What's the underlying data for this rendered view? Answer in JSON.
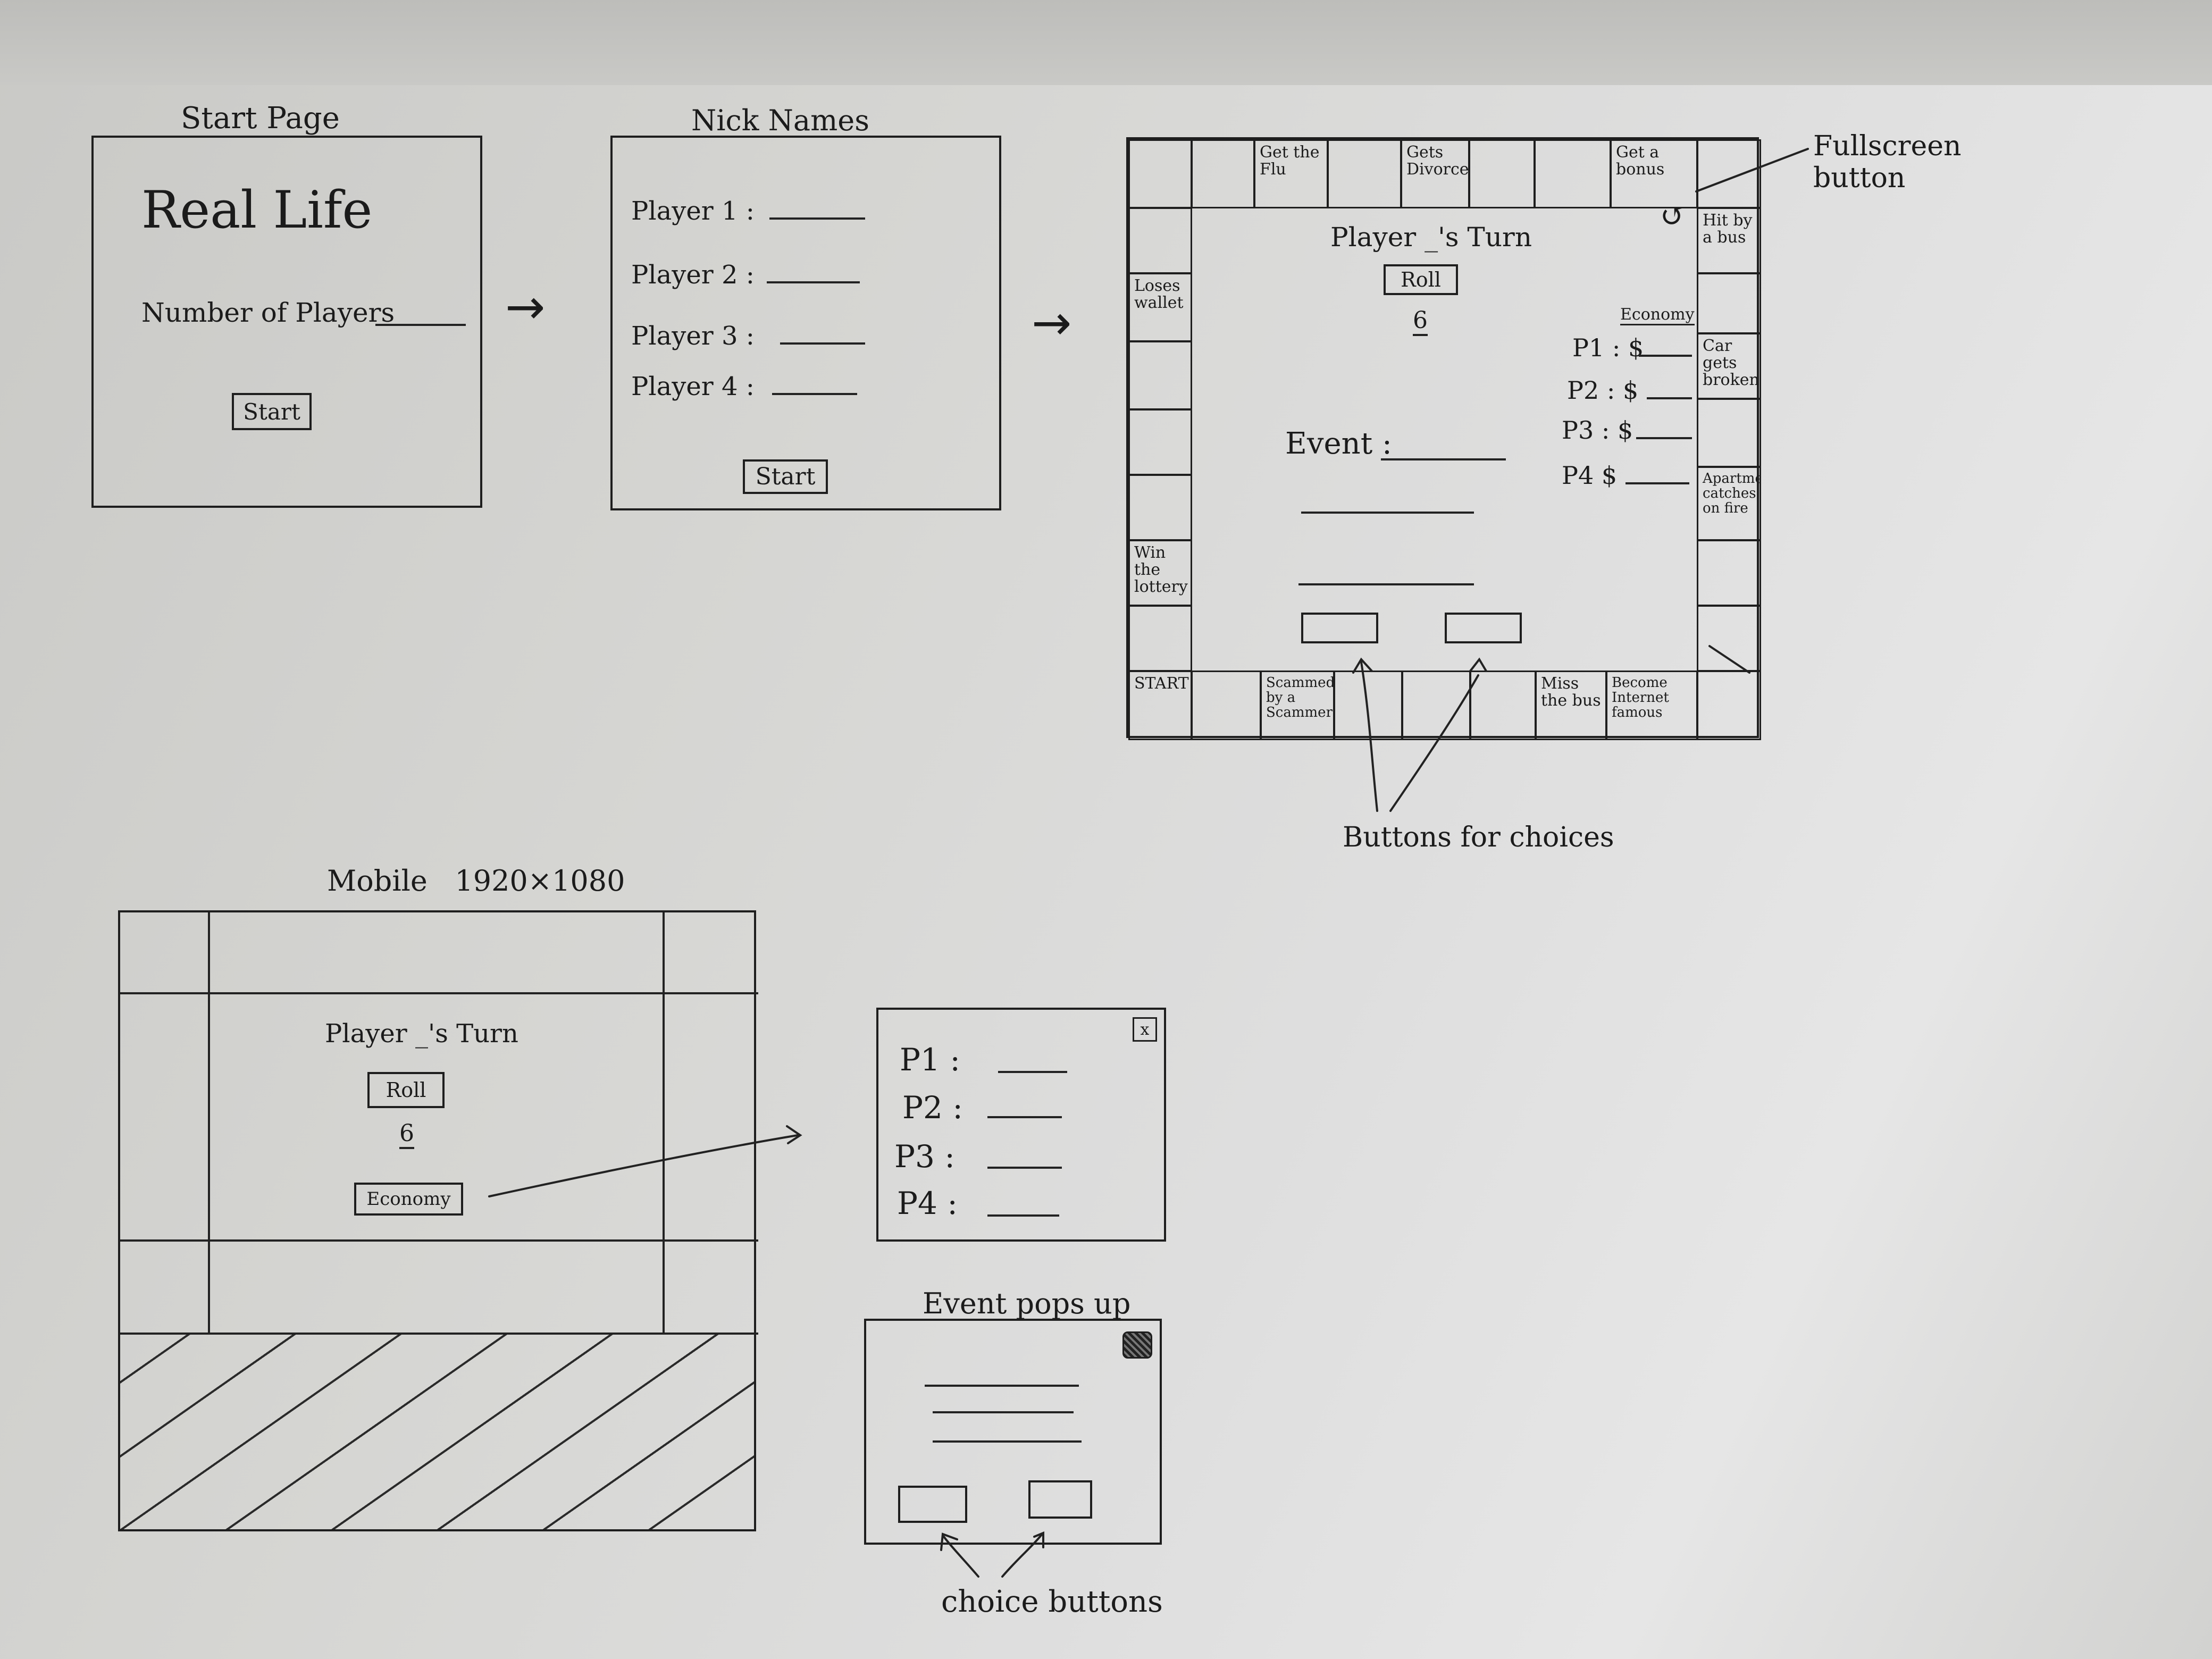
{
  "start_page": {
    "heading": "Start Page",
    "title": "Real Life",
    "num_players_label": "Number of Players",
    "start_button": "Start"
  },
  "nick_names": {
    "heading": "Nick Names",
    "players": [
      "Player 1 :",
      "Player 2 :",
      "Player 3 :",
      "Player 4 :"
    ],
    "start_button": "Start"
  },
  "flow_arrows": [
    "→",
    "→"
  ],
  "board": {
    "top_cells": [
      "Get the Flu",
      "Gets Divorced",
      "Get a bonus"
    ],
    "right_cells": [
      "Hit by a bus",
      "Car gets broken",
      "Apartment catches on fire"
    ],
    "left_cells": [
      "Loses wallet",
      "Win the lottery"
    ],
    "bottom_cells": [
      "START",
      "Scammed by a Scammer",
      "Miss the bus",
      "Become Internet famous"
    ],
    "turn_text": "Player _'s Turn",
    "roll_button": "Roll",
    "dice_value": "6",
    "event_label": "Event :",
    "economy_label": "Economy",
    "player_money": [
      "P1 : $",
      "P2 : $",
      "P3 : $",
      "P4 $"
    ]
  },
  "annotations": {
    "fullscreen": "Fullscreen button",
    "choice_buttons": "Buttons for choices",
    "choice_buttons_popup": "choice buttons"
  },
  "mobile": {
    "heading": "Mobile   1920×1080",
    "turn_text": "Player _'s Turn",
    "roll_button": "Roll",
    "dice_value": "6",
    "economy_button": "Economy"
  },
  "economy_popup": {
    "players": [
      "P1 :",
      "P2 :",
      "P3 :",
      "P4 :"
    ],
    "close": "x"
  },
  "event_popup": {
    "heading": "Event pops up"
  }
}
